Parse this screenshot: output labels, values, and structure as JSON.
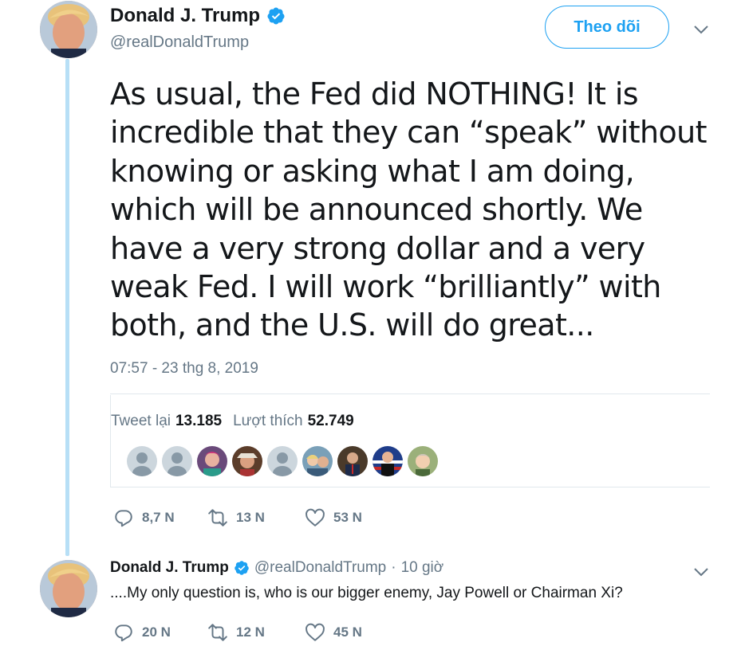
{
  "main_tweet": {
    "author": {
      "name": "Donald J. Trump",
      "handle": "@realDonaldTrump",
      "verified": true
    },
    "follow_label": "Theo dõi",
    "text": "As usual, the Fed did NOTHING! It is incredible that they can “speak” without knowing or asking what I am doing, which will be announced shortly. We have a very strong dollar and a very weak Fed. I will work “brilliantly” with both, and the U.S. will do great...",
    "timestamp": "07:57 - 23 thg 8, 2019",
    "stats": {
      "retweets_label": "Tweet lại",
      "retweets_count": "13.185",
      "likes_label": "Lượt thích",
      "likes_count": "52.749"
    },
    "likers": [
      "default-avatar",
      "default-avatar",
      "user-avatar",
      "user-avatar",
      "default-avatar",
      "user-avatar",
      "user-avatar",
      "user-avatar",
      "user-avatar"
    ],
    "actions": {
      "replies": "8,7 N",
      "retweets": "13 N",
      "likes": "53 N"
    }
  },
  "reply_tweet": {
    "author": {
      "name": "Donald J. Trump",
      "handle": "@realDonaldTrump",
      "verified": true
    },
    "separator": "·",
    "time": "10 giờ",
    "text": "....My only question is, who is our bigger enemy, Jay Powell or Chairman Xi?",
    "actions": {
      "replies": "20 N",
      "retweets": "12 N",
      "likes": "45 N"
    }
  },
  "colors": {
    "accent": "#1da1f2",
    "thread_line": "#b7dff6",
    "muted": "#657786",
    "text": "#14171a"
  },
  "icons": [
    "verified-badge-icon",
    "chevron-down-icon",
    "reply-icon",
    "retweet-icon",
    "like-icon"
  ]
}
